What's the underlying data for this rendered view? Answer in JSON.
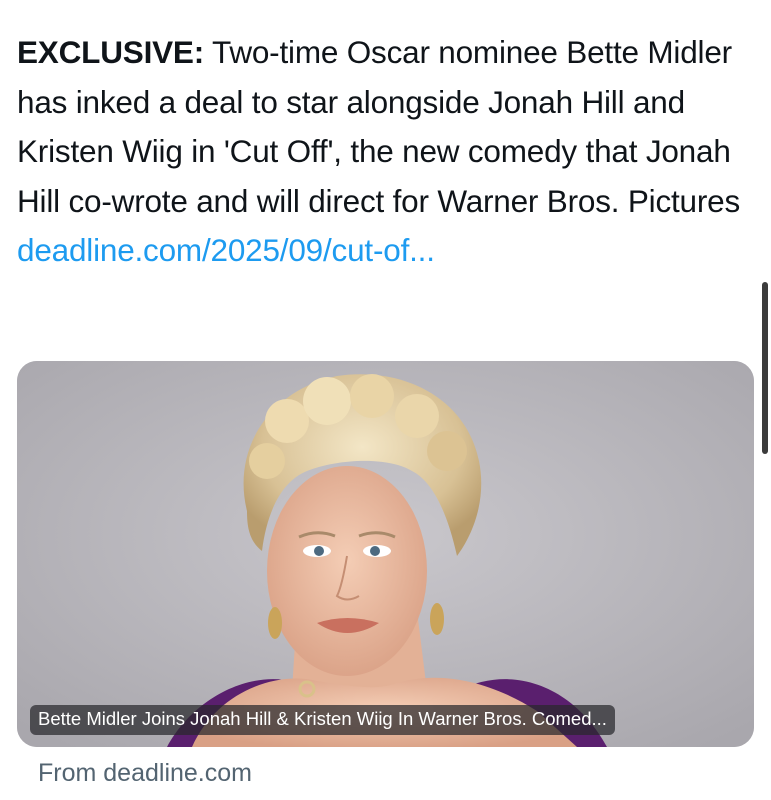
{
  "tweet": {
    "lead": "EXCLUSIVE:",
    "body": " Two-time Oscar nominee Bette Midler has inked a deal to star alongside Jonah Hill and Kristen Wiig in 'Cut Off', the new comedy that Jonah Hill co-wrote and will direct for Warner Bros. Pictures",
    "link_text": "deadline.com/2025/09/cut-of..."
  },
  "card": {
    "image_alt": "Portrait of woman with curly platinum blonde hair resting chin on hands",
    "caption": "Bette Midler Joins Jonah Hill & Kristen Wiig In Warner Bros. Comed..."
  },
  "source": {
    "label": "From deadline.com"
  },
  "colors": {
    "link": "#1d9bf0",
    "text": "#0f1419",
    "muted": "#536471"
  }
}
